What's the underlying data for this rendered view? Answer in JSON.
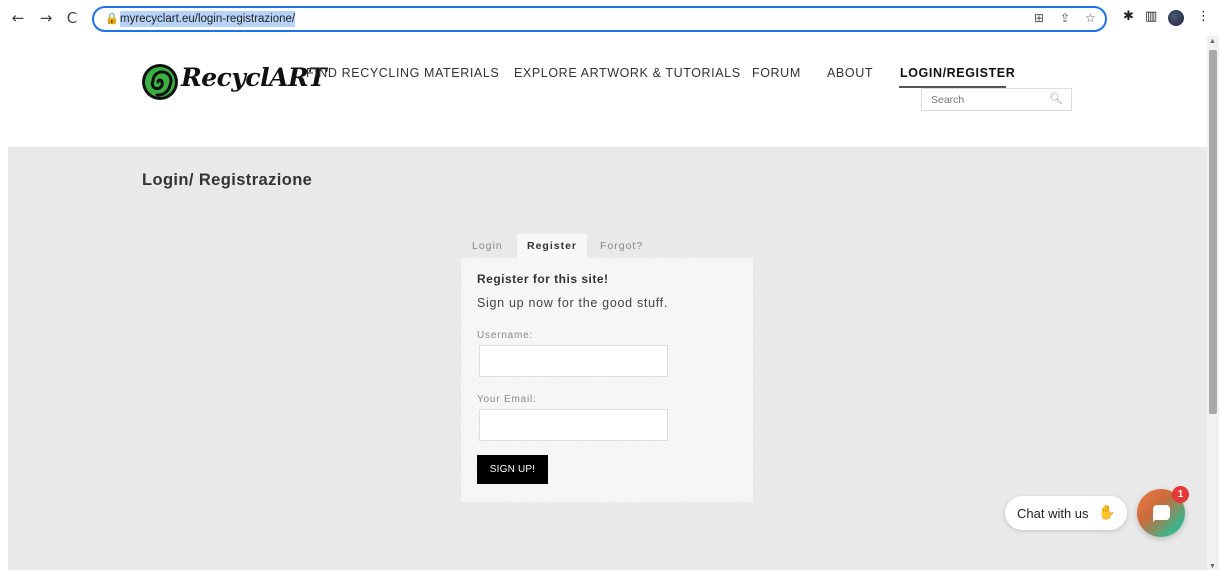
{
  "browser": {
    "url": "myrecyclart.eu/login-registrazione/"
  },
  "site": {
    "logo_text": "RecyclART",
    "nav": [
      {
        "label": "FIND RECYCLING MATERIALS"
      },
      {
        "label": "EXPLORE ARTWORK & TUTORIALS"
      },
      {
        "label": "FORUM"
      },
      {
        "label": "ABOUT"
      },
      {
        "label": "LOGIN/REGISTER"
      }
    ],
    "search_placeholder": "Search"
  },
  "page": {
    "title": "Login/ Registrazione",
    "tabs": [
      {
        "label": "Login"
      },
      {
        "label": "Register"
      },
      {
        "label": "Forgot?"
      }
    ],
    "active_tab": "Register",
    "panel": {
      "heading": "Register for this site!",
      "subheading": "Sign up now for the good stuff.",
      "username_label": "Username:",
      "email_label": "Your Email:",
      "submit_label": "SIGN UP!"
    }
  },
  "chat": {
    "prompt": "Chat with us",
    "badge_count": "1"
  },
  "colors": {
    "accent_focus": "#1a73e8",
    "content_bg": "#e9e9e9",
    "button_bg": "#000000",
    "badge": "#e53935"
  }
}
